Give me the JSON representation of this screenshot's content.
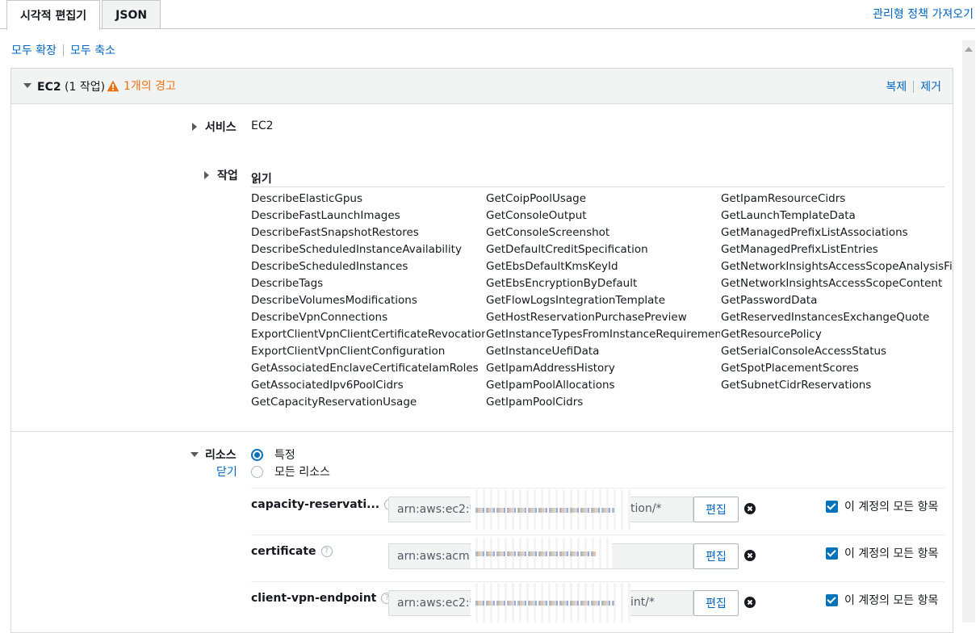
{
  "tabs": [
    {
      "label": "시각적 편집기",
      "active": true
    },
    {
      "label": "JSON",
      "active": false
    }
  ],
  "import_link": "관리형 정책 가져오기",
  "expand_all": "모두 확장",
  "collapse_all": "모두 축소",
  "service_header": {
    "name": "EC2",
    "count": "(1 작업)",
    "warning": "1개의 경고",
    "duplicate": "복제",
    "remove": "제거"
  },
  "service": {
    "label": "서비스",
    "value": "EC2"
  },
  "actions": {
    "label": "작업",
    "read_header": "읽기",
    "col1": [
      "DescribeElasticGpus",
      "DescribeFastLaunchImages",
      "DescribeFastSnapshotRestores",
      "DescribeScheduledInstanceAvailability",
      "DescribeScheduledInstances",
      "DescribeTags",
      "DescribeVolumesModifications",
      "DescribeVpnConnections",
      "ExportClientVpnClientCertificateRevocationList",
      "ExportClientVpnClientConfiguration",
      "GetAssociatedEnclaveCertificateIamRoles",
      "GetAssociatedIpv6PoolCidrs",
      "GetCapacityReservationUsage"
    ],
    "col2": [
      "GetCoipPoolUsage",
      "GetConsoleOutput",
      "GetConsoleScreenshot",
      "GetDefaultCreditSpecification",
      "GetEbsDefaultKmsKeyId",
      "GetEbsEncryptionByDefault",
      "GetFlowLogsIntegrationTemplate",
      "GetHostReservationPurchasePreview",
      "GetInstanceTypesFromInstanceRequirements",
      "GetInstanceUefiData",
      "GetIpamAddressHistory",
      "GetIpamPoolAllocations",
      "GetIpamPoolCidrs"
    ],
    "col3": [
      "GetIpamResourceCidrs",
      "GetLaunchTemplateData",
      "GetManagedPrefixListAssociations",
      "GetManagedPrefixListEntries",
      "GetNetworkInsightsAccessScopeAnalysisFindi",
      "GetNetworkInsightsAccessScopeContent",
      "GetPasswordData",
      "GetReservedInstancesExchangeQuote",
      "GetResourcePolicy",
      "GetSerialConsoleAccessStatus",
      "GetSpotPlacementScores",
      "GetSubnetCidrReservations"
    ]
  },
  "resources": {
    "label": "리소스",
    "close": "닫기",
    "option_specific": "특정",
    "option_all": "모든 리소스",
    "edit_label": "편집",
    "all_in_account": "이 계정의 모든 항목",
    "rows": [
      {
        "name": "capacity-reservati...",
        "arn_prefix": "arn:aws:ec2:*:",
        "arn_suffix": "tion/*"
      },
      {
        "name": "certificate",
        "arn_prefix": "arn:aws:acm:*",
        "arn_suffix": ""
      },
      {
        "name": "client-vpn-endpoint",
        "arn_prefix": "arn:aws:ec2:*:",
        "arn_suffix": "int/*"
      }
    ]
  }
}
